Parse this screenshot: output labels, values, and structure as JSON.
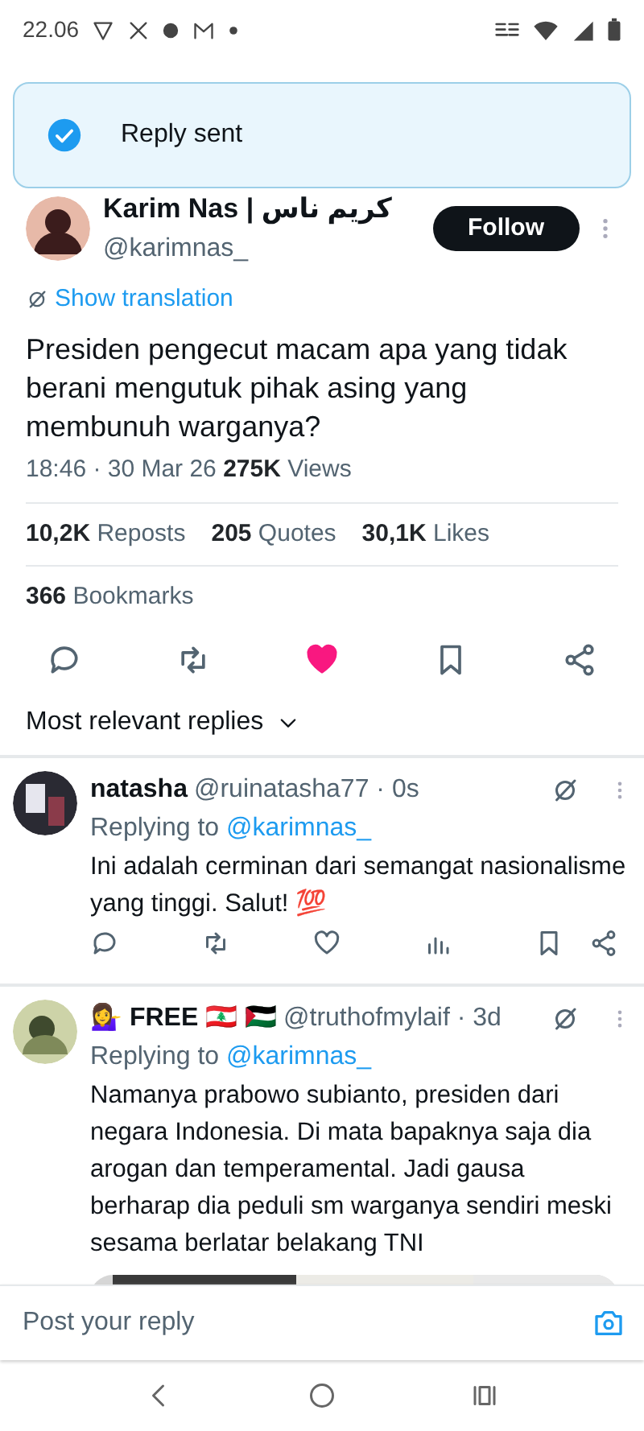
{
  "status_bar": {
    "time": "22.06"
  },
  "toast": {
    "text": "Reply sent"
  },
  "tweet": {
    "author_name": "Karim Nas | كريم ناس",
    "handle": "@karimnas_",
    "follow_button": "Follow",
    "show_translation": "Show translation",
    "text": "Presiden pengecut macam apa yang tidak berani mengutuk pihak asing yang membunuh warganya?",
    "time": "18:46 · 30 Mar 26",
    "views_count": "275K",
    "views_label": "Views",
    "stats": [
      {
        "count": "10,2K",
        "label": "Reposts"
      },
      {
        "count": "205",
        "label": "Quotes"
      },
      {
        "count": "30,1K",
        "label": "Likes"
      }
    ],
    "bookmarks": {
      "count": "366",
      "label": "Bookmarks"
    },
    "liked": true
  },
  "replies_sort": "Most relevant replies",
  "replies": [
    {
      "name": "natasha",
      "meta": "@ruinatasha77 · 0s",
      "replying_label": "Replying to",
      "replying_handle": "@karimnas_",
      "text": "Ini adalah cerminan dari semangat nasionalisme yang tinggi. Salut! 💯",
      "liked": false
    },
    {
      "name": "💁‍♀️ FREE 🇱🇧 🇵🇸",
      "meta": "@truthofmylaif · 3d",
      "replying_label": "Replying to",
      "replying_handle": "@karimnas_",
      "text": "Namanya prabowo subianto, presiden dari negara Indonesia. Di mata bapaknya saja dia arogan dan temperamental. Jadi gausa berharap dia peduli sm warganya sendiri meski sesama berlatar belakang TNI"
    }
  ],
  "reply_box": {
    "placeholder": "Post your reply"
  }
}
